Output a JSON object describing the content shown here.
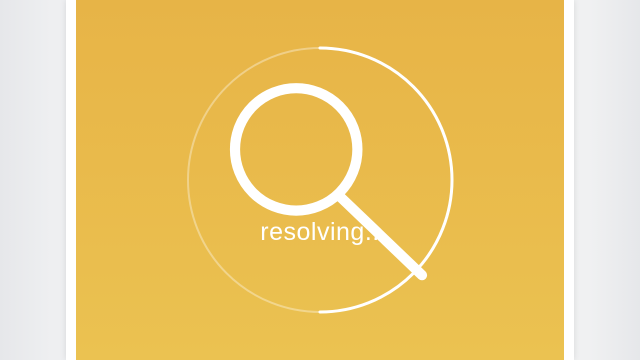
{
  "status": {
    "text": "resolving.."
  },
  "icons": {
    "center": "search-icon"
  },
  "progress": {
    "fraction": 0.5
  },
  "colors": {
    "panel_top": "#e7b447",
    "panel_bottom": "#ebc251",
    "ring": "#ffffff",
    "ring_track": "rgba(255,255,255,0.35)",
    "text": "#ffffff"
  }
}
